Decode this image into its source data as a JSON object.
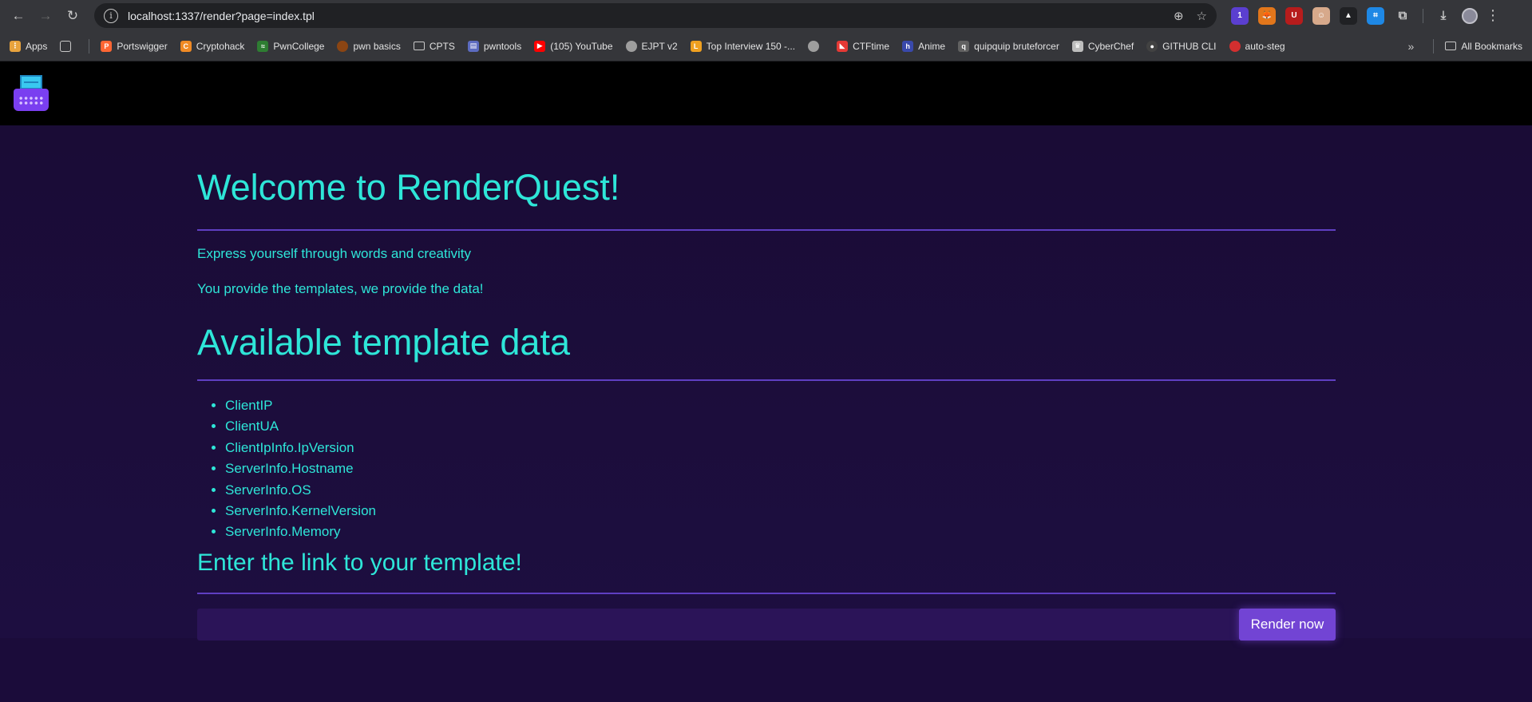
{
  "browser": {
    "url_host": "localhost",
    "url_path": ":1337/render?page=index.tpl",
    "bookmarks": [
      {
        "label": "Apps",
        "color": "#e8a33d"
      },
      {
        "label": "Portswigger",
        "color": "#ff6633"
      },
      {
        "label": "Cryptohack",
        "color": "#f08a24"
      },
      {
        "label": "PwnCollege",
        "color": "#2e7d32"
      },
      {
        "label": "pwn basics",
        "color": "#8b4513"
      },
      {
        "label": "CPTS",
        "color": "#6c6c6c"
      },
      {
        "label": "pwntools",
        "color": "#5c6bc0"
      },
      {
        "label": "(105) YouTube",
        "color": "#ff0000"
      },
      {
        "label": "EJPT v2",
        "color": "#9e9e9e"
      },
      {
        "label": "Top Interview 150 -...",
        "color": "#f0a020"
      },
      {
        "label": "",
        "color": "#9e9e9e"
      },
      {
        "label": "CTFtime",
        "color": "#e53935"
      },
      {
        "label": "Anime",
        "color": "#3949ab"
      },
      {
        "label": "quipquip bruteforcer",
        "color": "#616161"
      },
      {
        "label": "CyberChef",
        "color": "#bdbdbd"
      },
      {
        "label": "GITHUB CLI",
        "color": "#424242"
      },
      {
        "label": "auto-steg",
        "color": "#d32f2f"
      }
    ],
    "all_bookmarks": "All Bookmarks"
  },
  "page": {
    "title": "Welcome to RenderQuest!",
    "tagline": "Express yourself through words and creativity",
    "tagline2": "You provide the templates, we provide the data!",
    "data_heading": "Available template data",
    "template_vars": [
      "ClientIP",
      "ClientUA",
      "ClientIpInfo.IpVersion",
      "ServerInfo.Hostname",
      "ServerInfo.OS",
      "ServerInfo.KernelVersion",
      "ServerInfo.Memory"
    ],
    "link_heading": "Enter the link to your template!",
    "input_value": "",
    "button_label": "Render now"
  }
}
